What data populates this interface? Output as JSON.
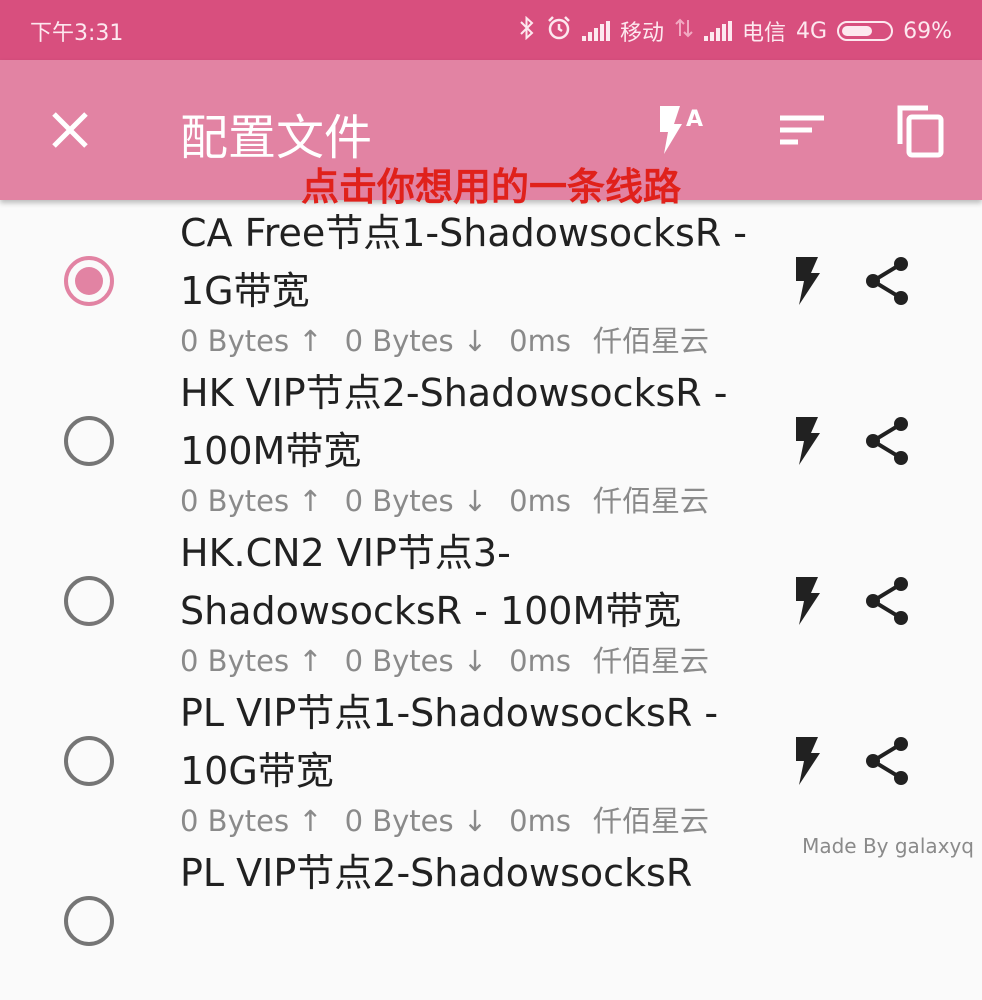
{
  "status_bar": {
    "time": "下午3:31",
    "carrier1": "移动",
    "carrier2": "电信",
    "network": "4G",
    "battery": "69%",
    "battery_level": 0.69
  },
  "app_bar": {
    "title": "配置文件",
    "hint": "点击你想用的一条线路",
    "accent_color": "#e283a3",
    "hint_color": "#e0211b"
  },
  "profiles": [
    {
      "name": "CA Free节点1-ShadowsocksR - 1G带宽",
      "up": "0 Bytes ↑",
      "down": "0 Bytes ↓",
      "latency": "0ms",
      "group": "仟佰星云",
      "selected": true
    },
    {
      "name": "HK VIP节点2-ShadowsocksR - 100M带宽",
      "up": "0 Bytes ↑",
      "down": "0 Bytes ↓",
      "latency": "0ms",
      "group": "仟佰星云",
      "selected": false
    },
    {
      "name": "HK.CN2 VIP节点3-ShadowsocksR - 100M带宽",
      "up": "0 Bytes ↑",
      "down": "0 Bytes ↓",
      "latency": "0ms",
      "group": "仟佰星云",
      "selected": false
    },
    {
      "name": "PL VIP节点1-ShadowsocksR - 10G带宽",
      "up": "0 Bytes ↑",
      "down": "0 Bytes ↓",
      "latency": "0ms",
      "group": "仟佰星云",
      "selected": false
    },
    {
      "name": "PL VIP节点2-ShadowsocksR",
      "up": "",
      "down": "",
      "latency": "",
      "group": "",
      "selected": false
    }
  ],
  "watermark": "Made By galaxyq"
}
